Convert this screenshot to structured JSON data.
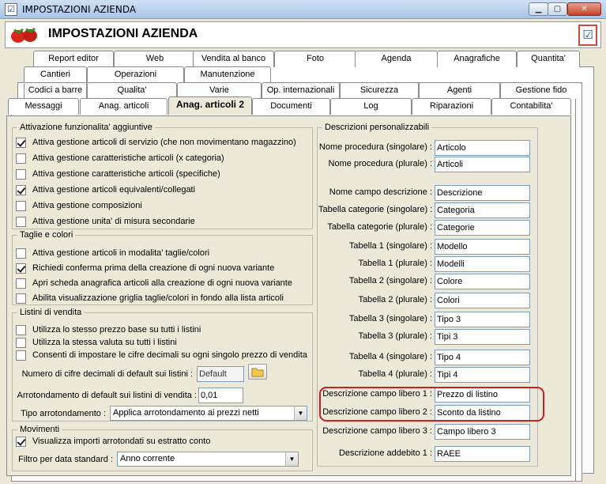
{
  "window": {
    "title": "IMPOSTAZIONI AZIENDA",
    "min_icon": "minimize-icon",
    "max_icon": "maximize-icon",
    "close_icon": "close-icon"
  },
  "header": {
    "title": "IMPOSTAZIONI AZIENDA",
    "logo_icon": "strawberries-logo",
    "confirm_icon": "checklist-icon"
  },
  "tabs": {
    "row1": [
      "Report editor",
      "Web",
      "Vendita al banco",
      "Foto",
      "Agenda",
      "Anagrafiche",
      "Quantita'"
    ],
    "row2": [
      "Cantieri",
      "Operazioni",
      "Manutenzione"
    ],
    "row3": [
      "Codici a barre",
      "Qualita'",
      "Varie",
      "Op. internazionali",
      "Sicurezza",
      "Agenti",
      "Gestione fido"
    ],
    "row4": [
      "Messaggi",
      "Anag. articoli",
      "Anag. articoli 2",
      "Documenti",
      "Log",
      "Riparazioni",
      "Contabilita'"
    ],
    "active": "Anag. articoli 2"
  },
  "attivazione": {
    "legend": "Attivazione funzionalita' aggiuntive",
    "items": [
      {
        "label": "Attiva gestione articoli di servizio (che non movimentano magazzino)",
        "checked": true
      },
      {
        "label": "Attiva gestione caratteristiche articoli (x categoria)",
        "checked": false
      },
      {
        "label": "Attiva gestione caratteristiche articoli (specifiche)",
        "checked": false
      },
      {
        "label": "Attiva gestione articoli equivalenti/collegati",
        "checked": true
      },
      {
        "label": "Attiva gestione composizioni",
        "checked": false
      },
      {
        "label": "Attiva gestione unita' di misura secondarie",
        "checked": false
      }
    ]
  },
  "taglie": {
    "legend": "Taglie e colori",
    "items": [
      {
        "label": "Attiva gestione articoli in modalita' taglie/colori",
        "checked": false
      },
      {
        "label": "Richiedi conferma prima della creazione di ogni nuova variante",
        "checked": true
      },
      {
        "label": "Apri scheda anagrafica articoli alla creazione di ogni nuova variante",
        "checked": false
      },
      {
        "label": "Abilita visualizzazione griglia taglie/colori in fondo alla lista articoli",
        "checked": false
      }
    ]
  },
  "listini": {
    "legend": "Listini di vendita",
    "items": [
      {
        "label": "Utilizza lo stesso prezzo base su tutti i listini",
        "checked": false
      },
      {
        "label": "Utilizza la stessa valuta su tutti i listini",
        "checked": false
      },
      {
        "label": "Consenti di impostare le cifre decimali su ogni singolo prezzo di vendita",
        "checked": false
      }
    ],
    "decimali_label": "Numero di cifre decimali di default sui listini :",
    "decimali_value": "Default",
    "folder_icon": "folder-icon",
    "arrotondamento_label": "Arrotondamento di default sui listini di vendita :",
    "arrotondamento_value": "0,01",
    "tipo_label": "Tipo arrotondamento :",
    "tipo_value": "Applica arrotondamento ai prezzi netti"
  },
  "movimenti": {
    "legend": "Movimenti",
    "items": [
      {
        "label": "Visualizza importi arrotondati su estratto conto",
        "checked": true
      }
    ],
    "filtro_label": "Filtro per data standard :",
    "filtro_value": "Anno corrente"
  },
  "descrizioni": {
    "legend": "Descrizioni personalizzabili",
    "fields": [
      {
        "label": "Nome procedura (singolare) :",
        "value": "Articolo"
      },
      {
        "label": "Nome procedura (plurale) :",
        "value": "Articoli"
      },
      {
        "label": "Nome campo descrizione :",
        "value": "Descrizione"
      },
      {
        "label": "Tabella categorie (singolare) :",
        "value": "Categoria"
      },
      {
        "label": "Tabella categorie (plurale) :",
        "value": "Categorie"
      },
      {
        "label": "Tabella 1 (singolare) :",
        "value": "Modello"
      },
      {
        "label": "Tabella 1 (plurale) :",
        "value": "Modelli"
      },
      {
        "label": "Tabella 2 (singolare) :",
        "value": "Colore"
      },
      {
        "label": "Tabella 2 (plurale) :",
        "value": "Colori"
      },
      {
        "label": "Tabella 3 (singolare) :",
        "value": "Tipo 3"
      },
      {
        "label": "Tabella 3 (plurale) :",
        "value": "Tipi 3"
      },
      {
        "label": "Tabella 4 (singolare) :",
        "value": "Tipo 4"
      },
      {
        "label": "Tabella 4 (plurale) :",
        "value": "Tipi 4"
      },
      {
        "label": "Descrizione campo libero 1 :",
        "value": "Prezzo di listino"
      },
      {
        "label": "Descrizione campo libero 2 :",
        "value": "Sconto da listino"
      },
      {
        "label": "Descrizione campo libero 3 :",
        "value": "Campo libero 3"
      },
      {
        "label": "Descrizione addebito 1 :",
        "value": "RAEE"
      }
    ]
  },
  "colors": {
    "highlight": "#cc1f1f",
    "panel": "#ece9d8"
  }
}
